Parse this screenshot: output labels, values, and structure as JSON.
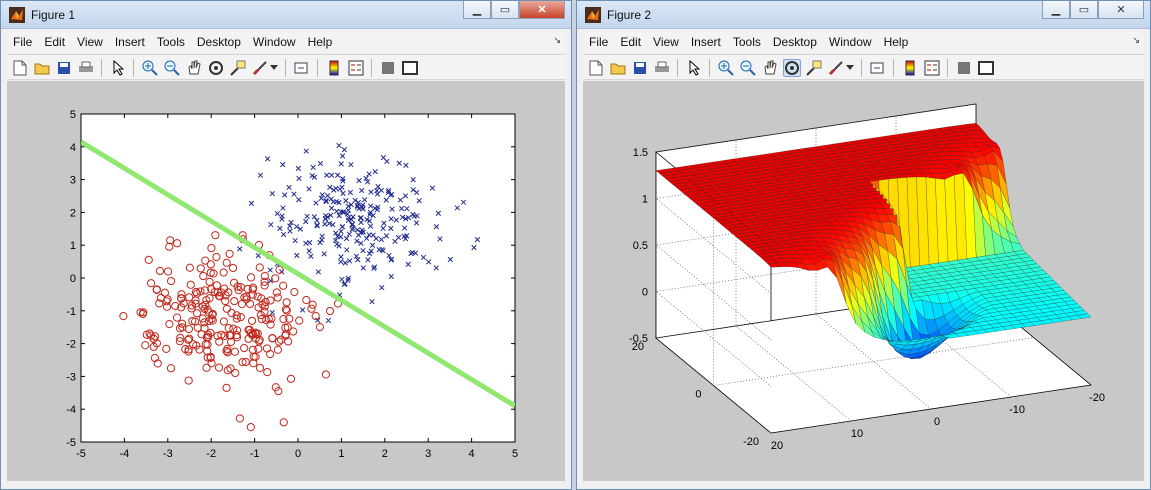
{
  "figure1": {
    "title": "Figure 1",
    "menu": [
      "File",
      "Edit",
      "View",
      "Insert",
      "Tools",
      "Desktop",
      "Window",
      "Help"
    ],
    "toolbar_icons": [
      "new-figure-icon",
      "open-file-icon",
      "save-icon",
      "print-icon",
      "pointer-icon",
      "zoom-in-icon",
      "zoom-out-icon",
      "pan-icon",
      "rotate-icon",
      "data-cursor-icon",
      "brush-icon",
      "link-icon",
      "colorbar-icon",
      "legend-icon",
      "hide-plot-tools-icon",
      "show-plot-tools-icon"
    ],
    "chart_data": {
      "type": "scatter",
      "xlim": [
        -5,
        5
      ],
      "ylim": [
        -5,
        5
      ],
      "xticks": [
        -5,
        -4,
        -3,
        -2,
        -1,
        0,
        1,
        2,
        3,
        4,
        5
      ],
      "yticks": [
        -5,
        -4,
        -3,
        -2,
        -1,
        0,
        1,
        2,
        3,
        4,
        5
      ],
      "xtick_labels": [
        "-5",
        "-4",
        "-3",
        "-2",
        "-1",
        "0",
        "1",
        "2",
        "3",
        "4",
        "5"
      ],
      "ytick_labels": [
        "-5",
        "-4",
        "-3",
        "-2",
        "-1",
        "0",
        "1",
        "2",
        "3",
        "4",
        "5"
      ],
      "series": [
        {
          "marker": "x",
          "color": "#1f2a8c",
          "center": [
            1.3,
            1.8
          ],
          "spread": [
            1.0,
            1.0
          ],
          "count": 250
        },
        {
          "marker": "o",
          "color": "#c0281c",
          "center": [
            -1.8,
            -1.2
          ],
          "spread": [
            1.0,
            1.0
          ],
          "count": 250
        }
      ],
      "boundary": {
        "color": "#90e870",
        "x": [
          -5,
          5
        ],
        "y": [
          4.15,
          -3.9
        ]
      }
    }
  },
  "figure2": {
    "title": "Figure 2",
    "menu": [
      "File",
      "Edit",
      "View",
      "Insert",
      "Tools",
      "Desktop",
      "Window",
      "Help"
    ],
    "toolbar_icons": [
      "new-figure-icon",
      "open-file-icon",
      "save-icon",
      "print-icon",
      "pointer-icon",
      "zoom-in-icon",
      "zoom-out-icon",
      "pan-icon",
      "rotate-icon",
      "data-cursor-icon",
      "brush-icon",
      "link-icon",
      "colorbar-icon",
      "legend-icon",
      "hide-plot-tools-icon",
      "show-plot-tools-icon"
    ],
    "chart_data": {
      "type": "surface",
      "zlim": [
        -0.5,
        1.5
      ],
      "zticks": [
        "1.5",
        "1",
        "0.5",
        "0",
        "-0.5"
      ],
      "xtick_labels": [
        "-20",
        "-10",
        "0",
        "10",
        "20"
      ],
      "ytick_labels": [
        "20",
        "0",
        "-20"
      ],
      "colormap": "jet"
    }
  }
}
